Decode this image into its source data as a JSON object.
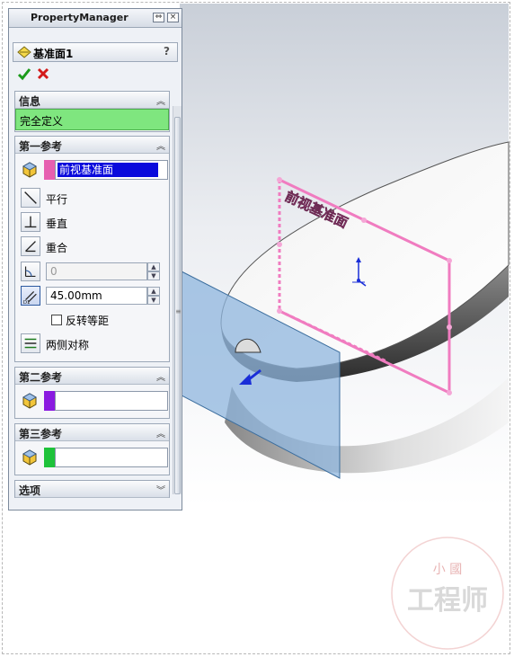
{
  "panel": {
    "title": "PropertyManager",
    "pin_icon": "pin-icon",
    "close_icon": "close-icon"
  },
  "feature": {
    "name": "基准面1",
    "help": "?",
    "icon": "plane-icon"
  },
  "actions": {
    "ok_icon": "checkmark-icon",
    "cancel_icon": "x-icon",
    "ok_color": "#1a9a1a",
    "cancel_color": "#d31a1a"
  },
  "info_group": {
    "title": "信息",
    "status": "完全定义",
    "status_color": "#7fe67f"
  },
  "first_ref": {
    "title": "第一参考",
    "selection": "前视基准面",
    "swatch_color": "#e65fb0",
    "options": [
      {
        "label": "平行",
        "icon": "parallel-icon"
      },
      {
        "label": "垂直",
        "icon": "perpendicular-icon"
      },
      {
        "label": "重合",
        "icon": "coincident-icon"
      }
    ],
    "angle_value": "0",
    "offset_value": "45.00mm",
    "flip_label": "反转等距",
    "flip_checked": false,
    "symmetric_label": "两侧对称"
  },
  "second_ref": {
    "title": "第二参考",
    "swatch_color": "#8a1ae0",
    "selection": ""
  },
  "third_ref": {
    "title": "第三参考",
    "swatch_color": "#1ec23a",
    "selection": ""
  },
  "options_group": {
    "title": "选项"
  },
  "viewport": {
    "plane_label": "前视基准面",
    "plane_color": "#f07cc0",
    "new_plane_color": "#8fb6dd"
  },
  "watermark": {
    "line1": "小 國",
    "line2": "工程师"
  }
}
